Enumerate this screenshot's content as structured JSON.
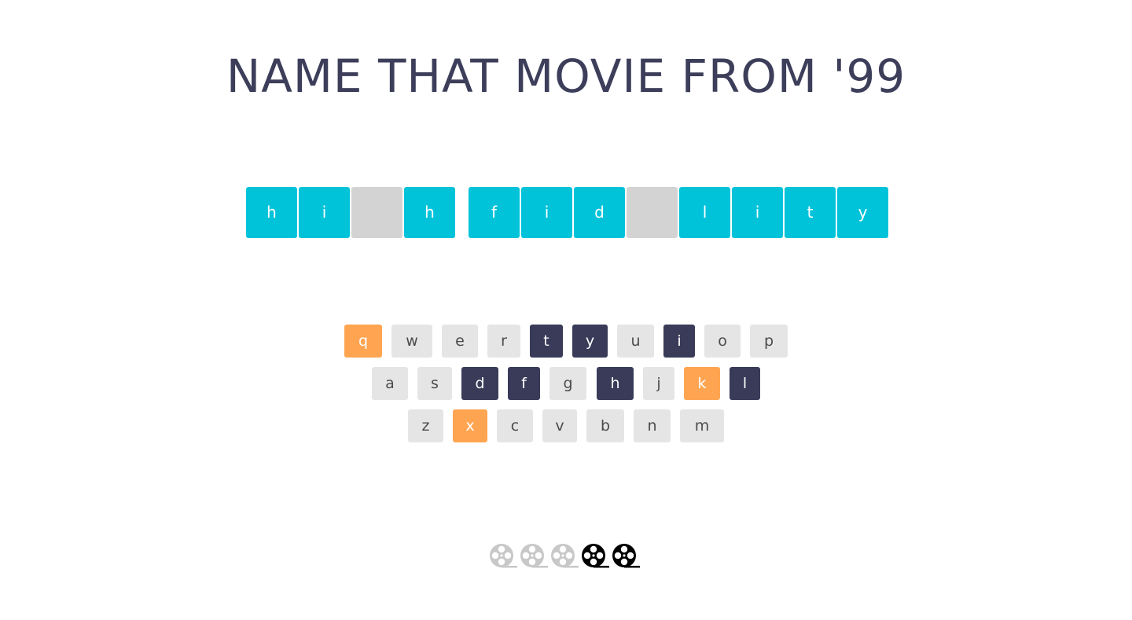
{
  "title": "NAME THAT MOVIE FROM '99",
  "colors": {
    "title": "#3c3e5a",
    "tile_filled": "#00c3da",
    "tile_blank": "#d3d3d3",
    "key_unused": "#e5e5e5",
    "key_correct": "#393b59",
    "key_wrong": "#ffa552",
    "life_remaining": "#000000",
    "life_lost": "#c8c8c8"
  },
  "puzzle": {
    "words": [
      [
        {
          "letter": "h",
          "revealed": true
        },
        {
          "letter": "i",
          "revealed": true
        },
        {
          "letter": "",
          "revealed": false
        },
        {
          "letter": "h",
          "revealed": true
        }
      ],
      [
        {
          "letter": "f",
          "revealed": true
        },
        {
          "letter": "i",
          "revealed": true
        },
        {
          "letter": "d",
          "revealed": true
        },
        {
          "letter": "",
          "revealed": false
        },
        {
          "letter": "l",
          "revealed": true
        },
        {
          "letter": "i",
          "revealed": true
        },
        {
          "letter": "t",
          "revealed": true
        },
        {
          "letter": "y",
          "revealed": true
        }
      ]
    ]
  },
  "keyboard": {
    "rows": [
      [
        {
          "letter": "q",
          "state": "wrong"
        },
        {
          "letter": "w",
          "state": "unused"
        },
        {
          "letter": "e",
          "state": "unused"
        },
        {
          "letter": "r",
          "state": "unused"
        },
        {
          "letter": "t",
          "state": "correct"
        },
        {
          "letter": "y",
          "state": "correct"
        },
        {
          "letter": "u",
          "state": "unused"
        },
        {
          "letter": "i",
          "state": "correct"
        },
        {
          "letter": "o",
          "state": "unused"
        },
        {
          "letter": "p",
          "state": "unused"
        }
      ],
      [
        {
          "letter": "a",
          "state": "unused"
        },
        {
          "letter": "s",
          "state": "unused"
        },
        {
          "letter": "d",
          "state": "correct"
        },
        {
          "letter": "f",
          "state": "correct"
        },
        {
          "letter": "g",
          "state": "unused"
        },
        {
          "letter": "h",
          "state": "correct"
        },
        {
          "letter": "j",
          "state": "unused"
        },
        {
          "letter": "k",
          "state": "wrong"
        },
        {
          "letter": "l",
          "state": "correct"
        }
      ],
      [
        {
          "letter": "z",
          "state": "unused"
        },
        {
          "letter": "x",
          "state": "wrong"
        },
        {
          "letter": "c",
          "state": "unused"
        },
        {
          "letter": "v",
          "state": "unused"
        },
        {
          "letter": "b",
          "state": "unused"
        },
        {
          "letter": "n",
          "state": "unused"
        },
        {
          "letter": "m",
          "state": "unused"
        }
      ]
    ]
  },
  "lives": {
    "icon": "film-reel-icon",
    "total": 5,
    "remaining": 2
  }
}
